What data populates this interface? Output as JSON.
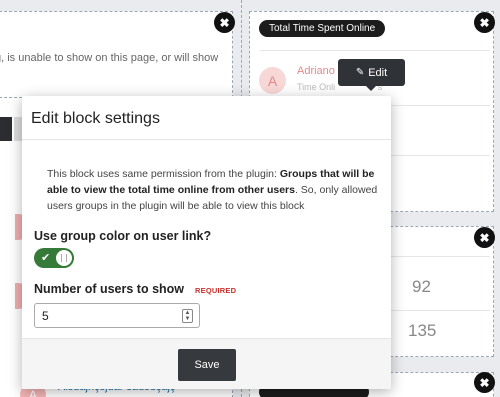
{
  "background": {
    "truncated_message": "g, is unable to show on this page, or will show",
    "total_time_block": {
      "title": "Total Time Spent Online",
      "user_name": "Adriano",
      "user_sub": "Time Onli",
      "user_sub_tail": "s",
      "avatar_letter": "A",
      "edit_label": "Edit"
    },
    "stats_values": [
      "92",
      "135"
    ],
    "bottom_user": {
      "name": "Alsdajhçsjdar sadsdçajç",
      "avatar_letter": "A"
    }
  },
  "modal": {
    "title": "Edit block settings",
    "description_pre": "This block uses same permission from the plugin: ",
    "description_bold": "Groups that will be able to view the total time online from other users",
    "description_post": ". So, only allowed users groups in the plugin will be able to view this block",
    "group_color_label": "Use group color on user link?",
    "group_color_enabled": true,
    "users_label": "Number of users to show",
    "required_label": "REQUIRED",
    "users_value": "5",
    "save_label": "Save"
  }
}
